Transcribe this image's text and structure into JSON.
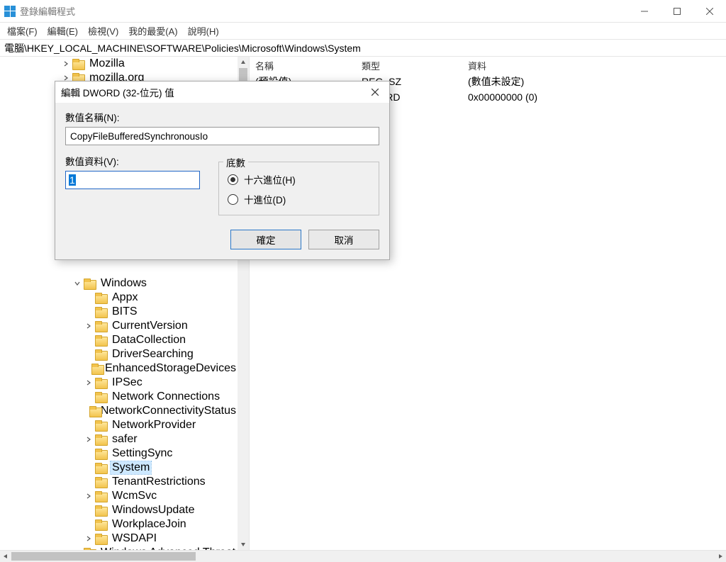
{
  "window": {
    "title": "登錄編輯程式",
    "controls": {
      "minimize": "—",
      "maximize": "☐",
      "close": "×"
    }
  },
  "menu": {
    "file": "檔案(F)",
    "edit": "編輯(E)",
    "view": "檢視(V)",
    "favorites": "我的最愛(A)",
    "help": "說明(H)"
  },
  "address": "電腦\\HKEY_LOCAL_MACHINE\\SOFTWARE\\Policies\\Microsoft\\Windows\\System",
  "tree": {
    "top": [
      {
        "label": "Mozilla",
        "expander": "right",
        "indent": 5
      },
      {
        "label": "mozilla.org",
        "expander": "right",
        "indent": 5
      }
    ],
    "windows": {
      "label": "Windows",
      "expander": "down",
      "indent": 6
    },
    "children": [
      {
        "label": "Appx",
        "expander": "none",
        "indent": 7
      },
      {
        "label": "BITS",
        "expander": "none",
        "indent": 7
      },
      {
        "label": "CurrentVersion",
        "expander": "right",
        "indent": 7
      },
      {
        "label": "DataCollection",
        "expander": "none",
        "indent": 7
      },
      {
        "label": "DriverSearching",
        "expander": "none",
        "indent": 7
      },
      {
        "label": "EnhancedStorageDevices",
        "expander": "none",
        "indent": 7
      },
      {
        "label": "IPSec",
        "expander": "right",
        "indent": 7
      },
      {
        "label": "Network Connections",
        "expander": "none",
        "indent": 7
      },
      {
        "label": "NetworkConnectivityStatus",
        "expander": "none",
        "indent": 7
      },
      {
        "label": "NetworkProvider",
        "expander": "none",
        "indent": 7
      },
      {
        "label": "safer",
        "expander": "right",
        "indent": 7
      },
      {
        "label": "SettingSync",
        "expander": "none",
        "indent": 7
      },
      {
        "label": "System",
        "expander": "none",
        "indent": 7,
        "selected": true
      },
      {
        "label": "TenantRestrictions",
        "expander": "none",
        "indent": 7
      },
      {
        "label": "WcmSvc",
        "expander": "right",
        "indent": 7
      },
      {
        "label": "WindowsUpdate",
        "expander": "none",
        "indent": 7
      },
      {
        "label": "WorkplaceJoin",
        "expander": "none",
        "indent": 7
      },
      {
        "label": "WSDAPI",
        "expander": "right",
        "indent": 7
      }
    ],
    "after": {
      "label": "Windows Advanced Threat",
      "expander": "right",
      "indent": 6
    }
  },
  "list": {
    "headers": {
      "name": "名稱",
      "type": "類型",
      "data": "資料"
    },
    "rows": [
      {
        "name": "(預設值)",
        "type": "REG_SZ",
        "data": "(數值未設定)"
      },
      {
        "name": "",
        "type": "DWORD",
        "data": "0x00000000 (0)"
      }
    ]
  },
  "dialog": {
    "title": "編輯 DWORD (32-位元) 值",
    "value_name_label": "數值名稱(N):",
    "value_name": "CopyFileBufferedSynchronousIo",
    "value_data_label": "數值資料(V):",
    "value_data": "1",
    "base_label": "底數",
    "hex_label": "十六進位(H)",
    "dec_label": "十進位(D)",
    "ok": "確定",
    "cancel": "取消"
  }
}
